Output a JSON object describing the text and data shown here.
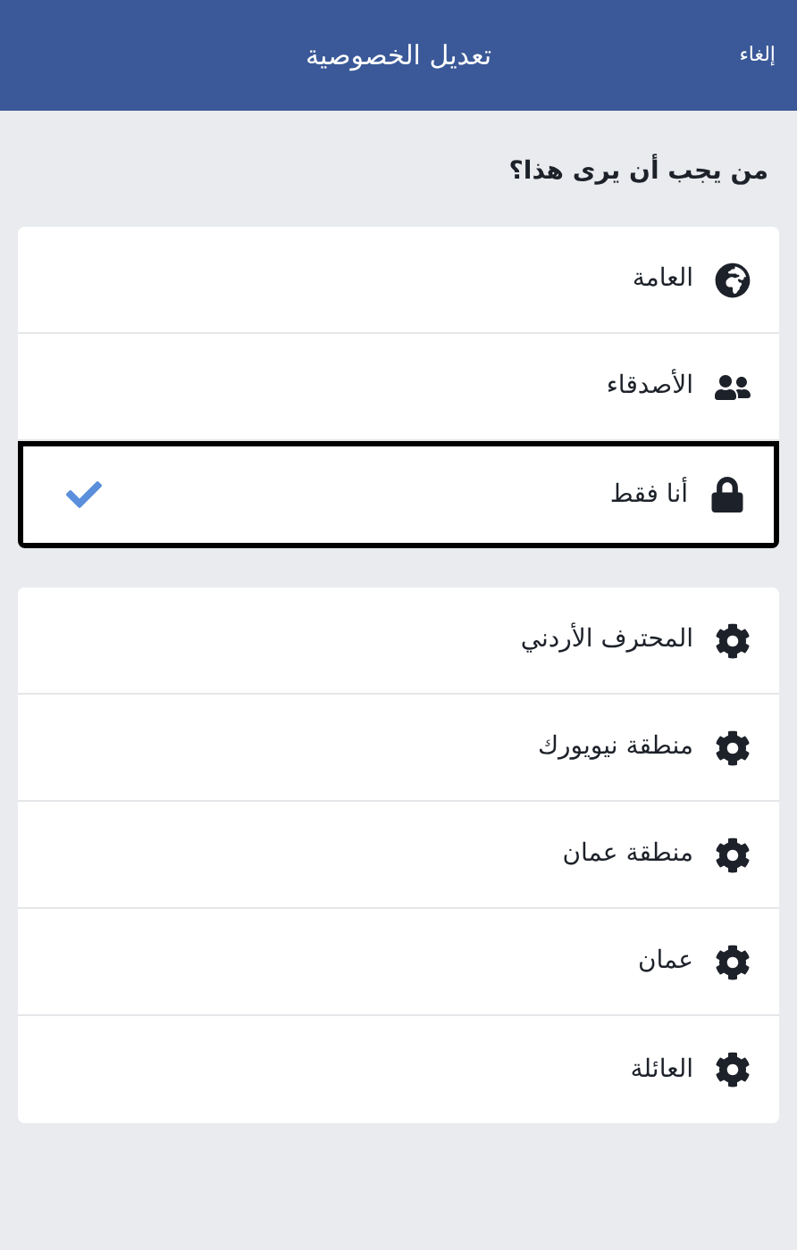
{
  "header": {
    "cancel": "إلغاء",
    "title": "تعديل الخصوصية"
  },
  "question": "من يجب أن يرى هذا؟",
  "audience": [
    {
      "label": "العامة",
      "kind": "public",
      "selected": false
    },
    {
      "label": "الأصدقاء",
      "kind": "friends",
      "selected": false
    },
    {
      "label": "أنا فقط",
      "kind": "private",
      "selected": true
    }
  ],
  "lists": [
    {
      "label": "المحترف الأردني"
    },
    {
      "label": "منطقة نيويورك"
    },
    {
      "label": "منطقة عمان"
    },
    {
      "label": "عمان"
    },
    {
      "label": "العائلة"
    }
  ]
}
